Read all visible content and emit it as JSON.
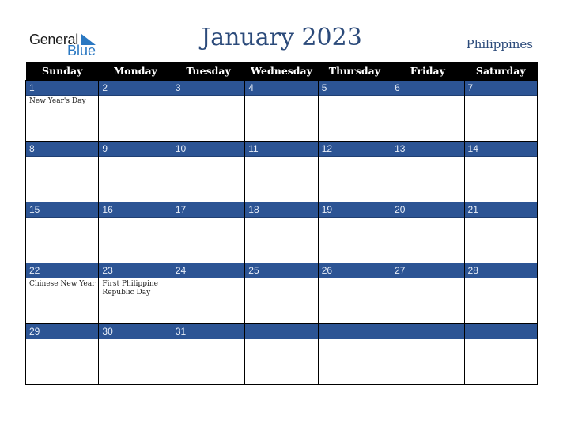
{
  "logo": {
    "line1": "General",
    "line2": "Blue"
  },
  "title": "January 2023",
  "country": "Philippines",
  "weekdays": [
    "Sunday",
    "Monday",
    "Tuesday",
    "Wednesday",
    "Thursday",
    "Friday",
    "Saturday"
  ],
  "weeks": [
    [
      {
        "day": "1",
        "holiday": "New Year's Day"
      },
      {
        "day": "2",
        "holiday": ""
      },
      {
        "day": "3",
        "holiday": ""
      },
      {
        "day": "4",
        "holiday": ""
      },
      {
        "day": "5",
        "holiday": ""
      },
      {
        "day": "6",
        "holiday": ""
      },
      {
        "day": "7",
        "holiday": ""
      }
    ],
    [
      {
        "day": "8",
        "holiday": ""
      },
      {
        "day": "9",
        "holiday": ""
      },
      {
        "day": "10",
        "holiday": ""
      },
      {
        "day": "11",
        "holiday": ""
      },
      {
        "day": "12",
        "holiday": ""
      },
      {
        "day": "13",
        "holiday": ""
      },
      {
        "day": "14",
        "holiday": ""
      }
    ],
    [
      {
        "day": "15",
        "holiday": ""
      },
      {
        "day": "16",
        "holiday": ""
      },
      {
        "day": "17",
        "holiday": ""
      },
      {
        "day": "18",
        "holiday": ""
      },
      {
        "day": "19",
        "holiday": ""
      },
      {
        "day": "20",
        "holiday": ""
      },
      {
        "day": "21",
        "holiday": ""
      }
    ],
    [
      {
        "day": "22",
        "holiday": "Chinese New Year"
      },
      {
        "day": "23",
        "holiday": "First Philippine Republic Day"
      },
      {
        "day": "24",
        "holiday": ""
      },
      {
        "day": "25",
        "holiday": ""
      },
      {
        "day": "26",
        "holiday": ""
      },
      {
        "day": "27",
        "holiday": ""
      },
      {
        "day": "28",
        "holiday": ""
      }
    ],
    [
      {
        "day": "29",
        "holiday": ""
      },
      {
        "day": "30",
        "holiday": ""
      },
      {
        "day": "31",
        "holiday": ""
      },
      {
        "day": "",
        "holiday": ""
      },
      {
        "day": "",
        "holiday": ""
      },
      {
        "day": "",
        "holiday": ""
      },
      {
        "day": "",
        "holiday": ""
      }
    ]
  ],
  "colors": {
    "header_bg": "#000000",
    "date_bar": "#2c5494",
    "title": "#2b4a7a",
    "logo_blue": "#2a78c2"
  }
}
